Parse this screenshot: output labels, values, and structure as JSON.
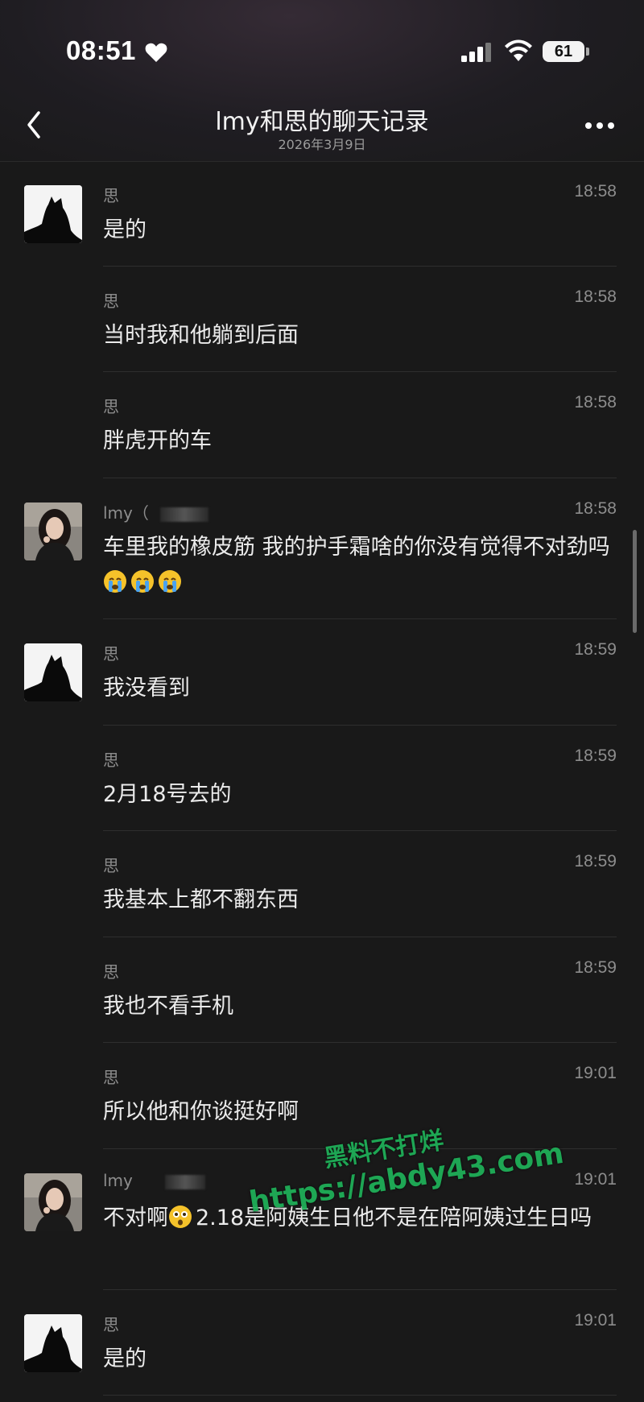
{
  "status_bar": {
    "time": "08:51",
    "battery": "61"
  },
  "header": {
    "title": "lmy和思的聊天记录",
    "date": "2026年3月9日"
  },
  "messages": [
    {
      "sender": "思",
      "time": "18:58",
      "text": "是的",
      "avatar": "cat"
    },
    {
      "sender": "思",
      "time": "18:58",
      "text": "当时我和他躺到后面",
      "avatar": ""
    },
    {
      "sender": "思",
      "time": "18:58",
      "text": "胖虎开的车",
      "avatar": ""
    },
    {
      "sender": "lmy（",
      "time": "18:58",
      "text": "车里我的橡皮筋 我的护手霜啥的你没有觉得不对劲吗",
      "avatar": "girl",
      "emoji": [
        "crying-face",
        "crying-face",
        "crying-face"
      ]
    },
    {
      "sender": "思",
      "time": "18:59",
      "text": "我没看到",
      "avatar": "cat"
    },
    {
      "sender": "思",
      "time": "18:59",
      "text": "2月18号去的",
      "avatar": ""
    },
    {
      "sender": "思",
      "time": "18:59",
      "text": "我基本上都不翻东西",
      "avatar": ""
    },
    {
      "sender": "思",
      "time": "18:59",
      "text": "我也不看手机",
      "avatar": ""
    },
    {
      "sender": "思",
      "time": "19:01",
      "text": "所以他和你谈挺好啊",
      "avatar": ""
    },
    {
      "sender": "lmy",
      "time": "19:01",
      "text_a": "不对啊",
      "text_b": "2.18是阿姨生日他不是在陪阿姨过生日吗",
      "avatar": "girl",
      "emoji_inline": "astonished-face"
    },
    {
      "sender": "思",
      "time": "19:01",
      "text": "是的",
      "avatar": "cat"
    }
  ],
  "watermark": {
    "line1": "黑料不打烊",
    "line2": "https://abdy43.com"
  },
  "colors": {
    "background": "#191919",
    "text": "#ebebeb",
    "meta": "#8d8d8d",
    "watermark": "#1fb35a"
  }
}
